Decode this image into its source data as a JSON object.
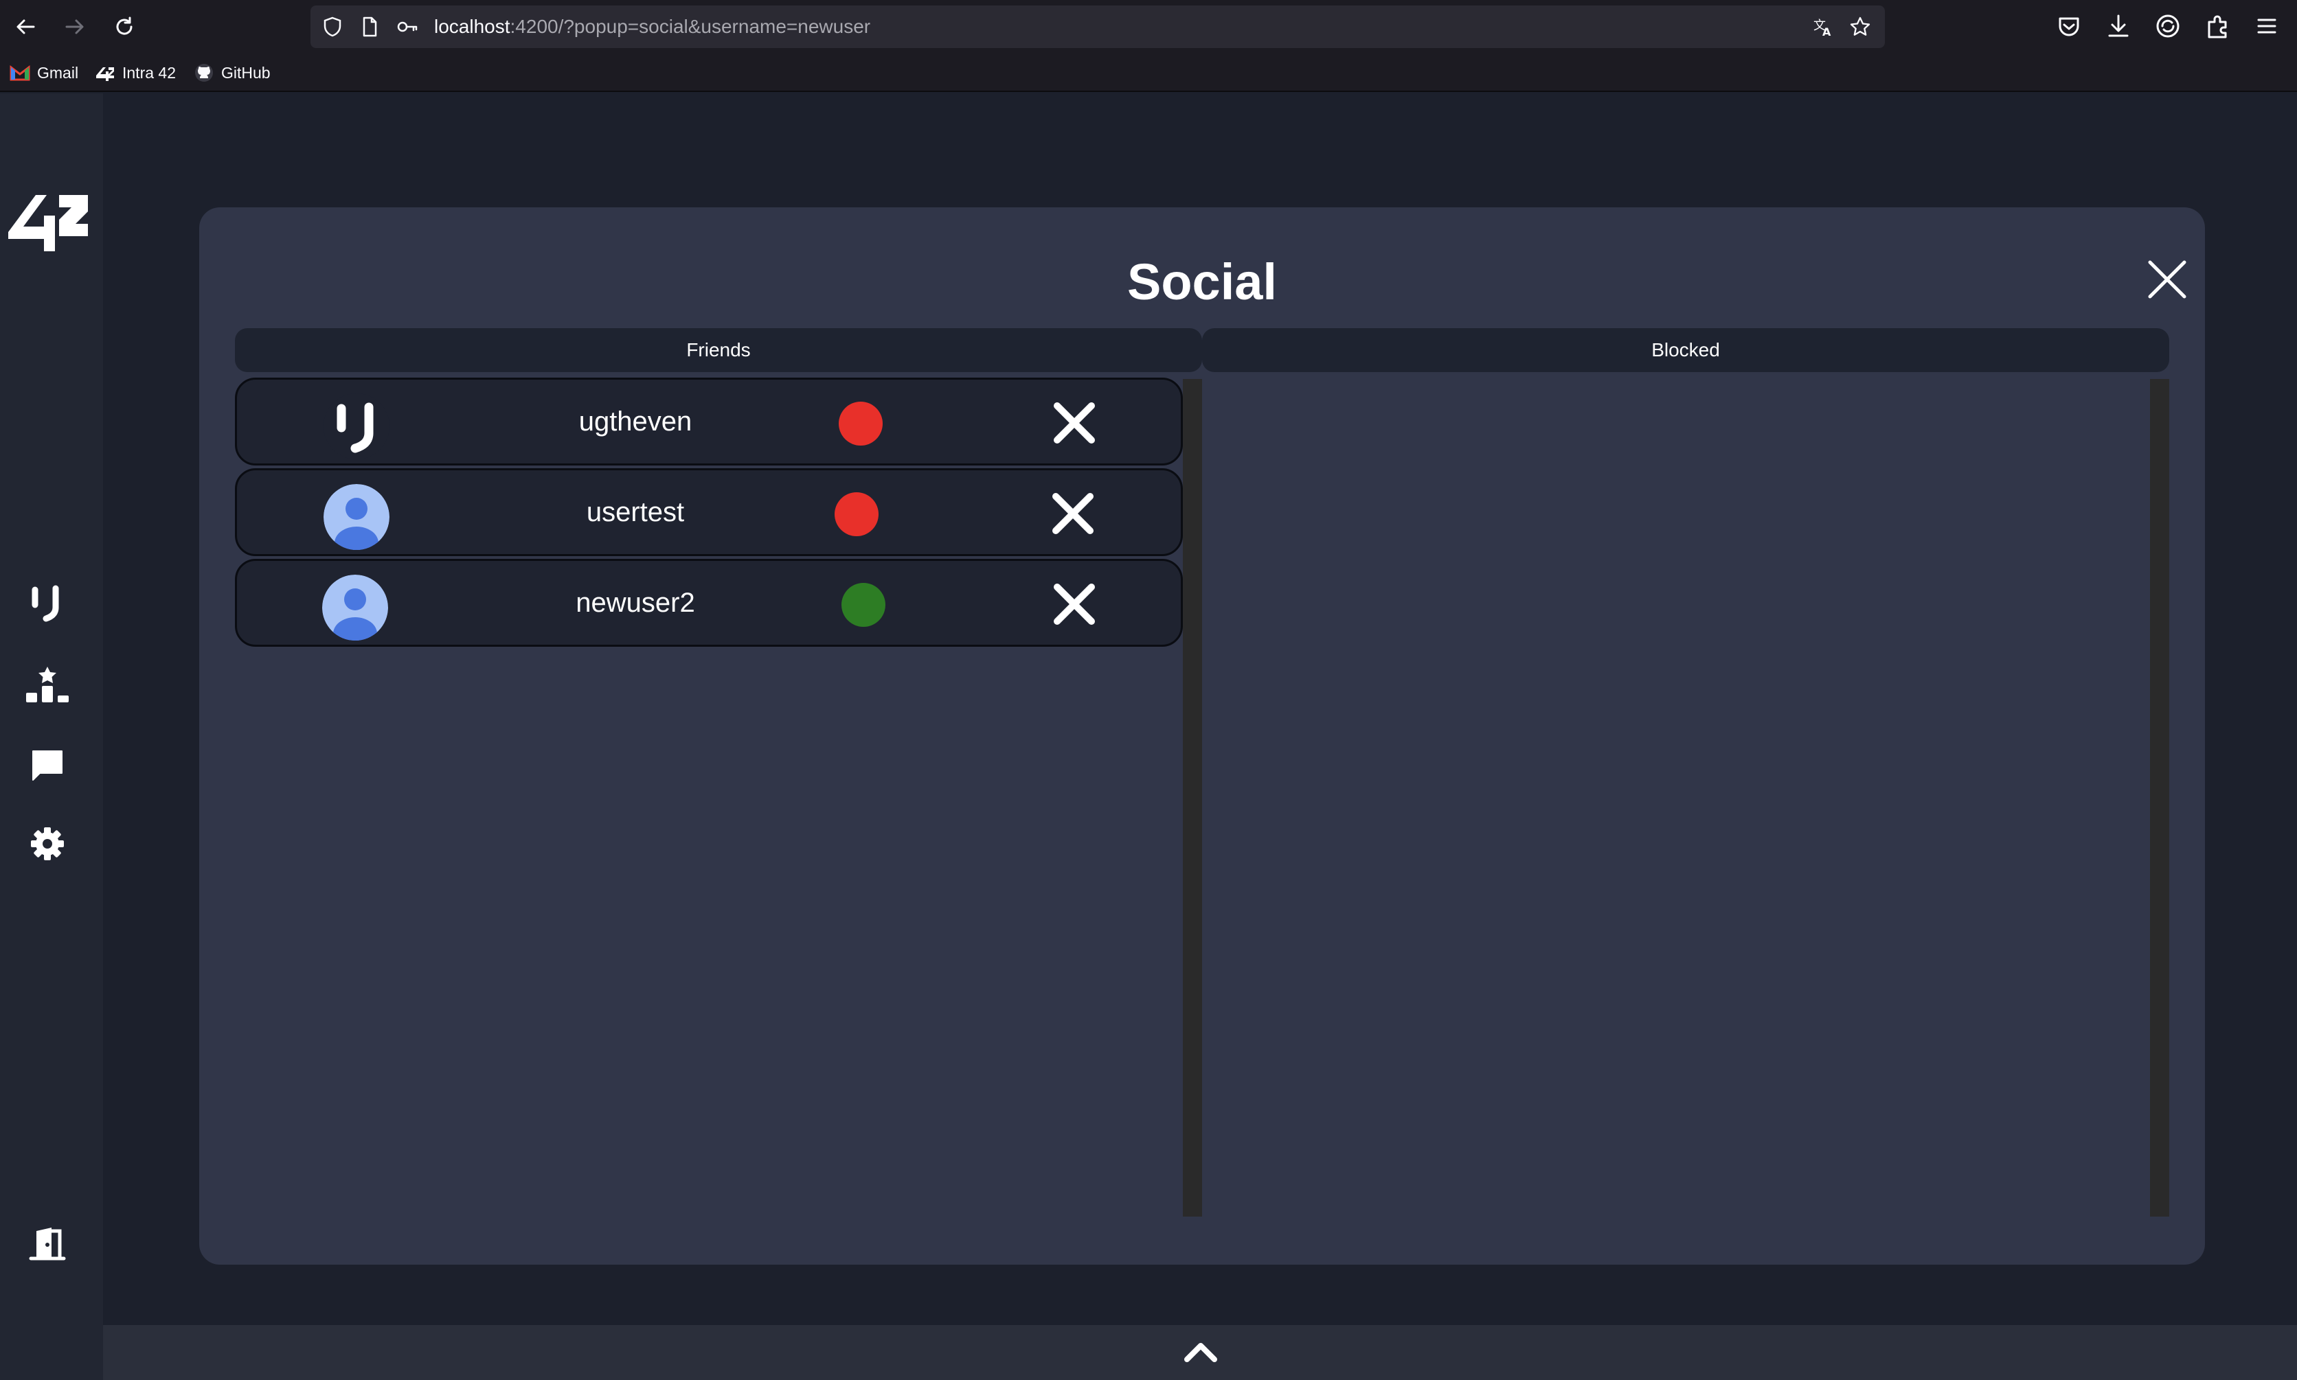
{
  "browser": {
    "url_host": "localhost",
    "url_rest": ":4200/?popup=social&username=newuser",
    "bookmarks": [
      "Gmail",
      "Intra 42",
      "GitHub"
    ]
  },
  "app": {
    "logo_text": "42"
  },
  "social": {
    "title": "Social",
    "friends_header": "Friends",
    "blocked_header": "Blocked",
    "friends": [
      {
        "name": "ugtheven",
        "status": "offline",
        "status_color": "#e8302a",
        "avatar": "42-logo-avatar"
      },
      {
        "name": "usertest",
        "status": "offline",
        "status_color": "#e8302a",
        "avatar": "default-person-avatar"
      },
      {
        "name": "newuser2",
        "status": "online",
        "status_color": "#2d7d24",
        "avatar": "default-person-avatar"
      }
    ],
    "blocked": []
  },
  "colors": {
    "modal_bg": "#313649",
    "page_bg": "#1c202c",
    "offline": "#e8302a",
    "online": "#2d7d24"
  }
}
